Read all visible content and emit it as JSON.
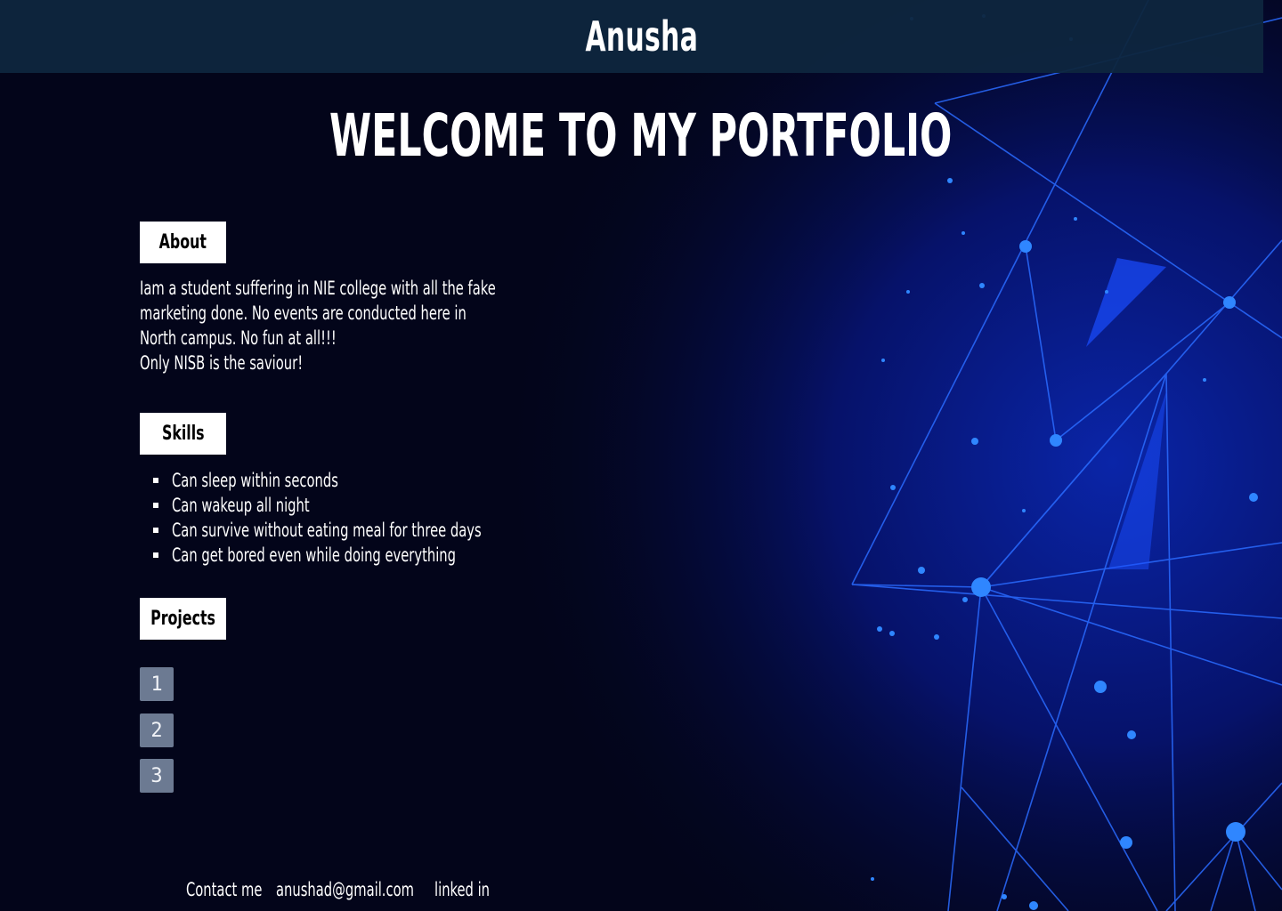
{
  "header": {
    "title": "Anusha"
  },
  "hero": {
    "title": "WELCOME TO MY PORTFOLIO"
  },
  "about": {
    "label": "About",
    "lines": [
      "Iam a student suffering in NIE college  with all the fake",
      "marketing done. No events are conducted here in",
      "North campus. No fun at all!!!",
      "Only NISB is the saviour!"
    ]
  },
  "skills": {
    "label": "Skills",
    "items": [
      "Can sleep within seconds",
      "Can wakeup all night",
      "Can survive without eating meal for three days",
      "Can get bored even while doing everything"
    ]
  },
  "projects": {
    "label": "Projects",
    "items": [
      "1",
      "2",
      "3"
    ]
  },
  "footer": {
    "contact": "Contact me",
    "email": "anushad@gmail.com",
    "linkedin": "linked in"
  },
  "colors": {
    "background": "#03051a",
    "header": "#0e263e",
    "network": "#1e5cff",
    "project_button": "#6c7a92"
  }
}
